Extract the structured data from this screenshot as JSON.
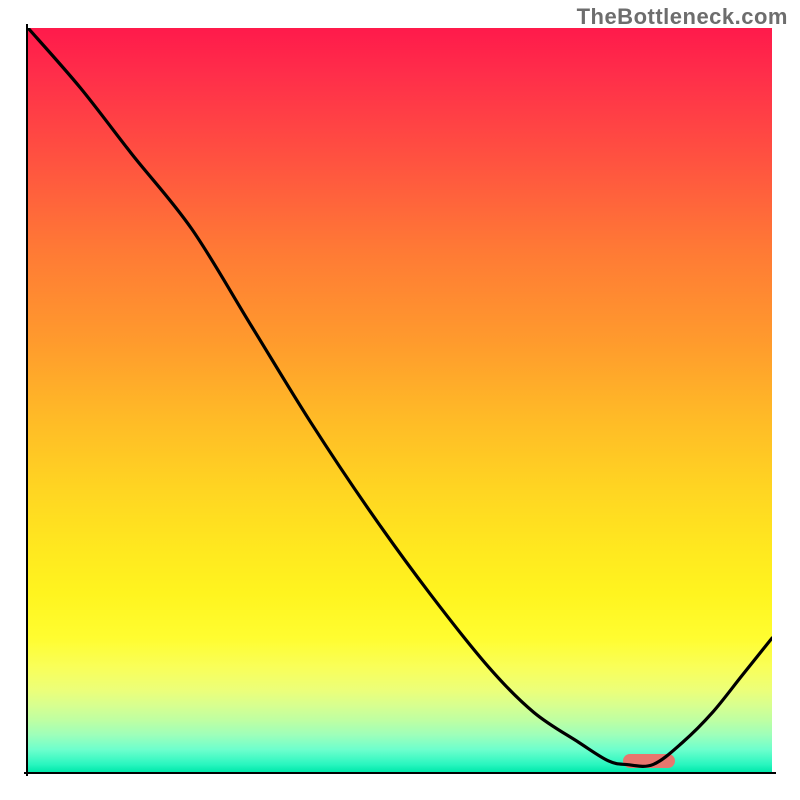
{
  "watermark": "TheBottleneck.com",
  "chart_data": {
    "type": "line",
    "title": "",
    "xlabel": "",
    "ylabel": "",
    "xlim": [
      0,
      100
    ],
    "ylim": [
      0,
      100
    ],
    "x": [
      0,
      7,
      14,
      22,
      30,
      38,
      46,
      54,
      62,
      68,
      74,
      78,
      80.5,
      84,
      88,
      92,
      96,
      100
    ],
    "values": [
      100,
      92,
      83,
      73,
      60,
      47,
      35,
      24,
      14,
      8,
      4,
      1.5,
      1,
      1,
      4,
      8,
      13,
      18
    ],
    "marker": {
      "x_start": 80,
      "x_end": 87,
      "y": 1.5
    },
    "gradient_stops": [
      {
        "pos": 0,
        "color": "#ff1a4b"
      },
      {
        "pos": 50,
        "color": "#ffc025"
      },
      {
        "pos": 82,
        "color": "#fffd30"
      },
      {
        "pos": 100,
        "color": "#00e8ab"
      }
    ]
  },
  "colors": {
    "curve": "#000000",
    "marker": "#e8766e",
    "watermark": "#6d6d6d"
  }
}
